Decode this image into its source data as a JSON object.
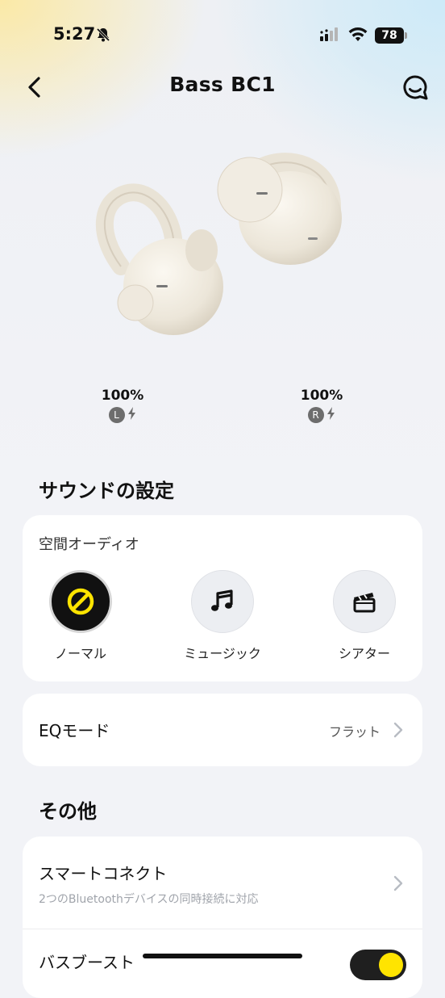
{
  "status_bar": {
    "time": "5:27",
    "battery_level": "78",
    "icons": [
      "bell-slash-icon",
      "signal-icon",
      "wifi-icon",
      "battery-icon"
    ]
  },
  "header": {
    "title": "Bass BC1",
    "back_icon": "chevron-left-icon",
    "chat_icon": "chat-bubble-icon"
  },
  "battery": {
    "left": {
      "percent": "100%",
      "side": "L",
      "charging_icon": "bolt-icon"
    },
    "right": {
      "percent": "100%",
      "side": "R",
      "charging_icon": "bolt-icon"
    }
  },
  "sound_settings": {
    "title": "サウンドの設定",
    "spatial_audio": {
      "label": "空間オーディオ",
      "modes": [
        {
          "label": "ノーマル",
          "icon": "no-sign-icon",
          "selected": true
        },
        {
          "label": "ミュージック",
          "icon": "music-note-icon",
          "selected": false
        },
        {
          "label": "シアター",
          "icon": "clapperboard-icon",
          "selected": false
        }
      ]
    },
    "eq": {
      "label": "EQモード",
      "value": "フラット"
    }
  },
  "other": {
    "title": "その他",
    "smart_connect": {
      "label": "スマートコネクト",
      "description": "2つのBluetoothデバイスの同時接続に対応"
    },
    "bass_boost": {
      "label": "バスブースト",
      "enabled": true
    }
  },
  "colors": {
    "accent": "#ffe400",
    "dark": "#111111",
    "card": "#ffffff",
    "background": "#f2f3f7"
  }
}
